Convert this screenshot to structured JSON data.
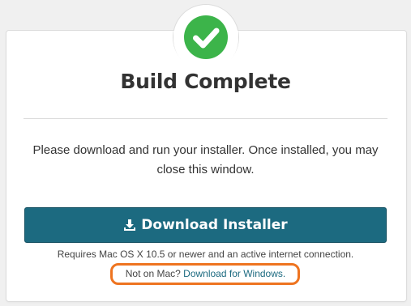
{
  "dialog": {
    "title": "Build Complete",
    "status_icon": "check-circle-icon",
    "message": "Please download and run your installer. Once installed, you may close this window.",
    "download_button": {
      "icon": "download-icon",
      "label": "Download Installer"
    },
    "requirements": "Requires Mac OS X 10.5 or newer and an active internet connection.",
    "alternate": {
      "prefix": "Not on Mac?",
      "link_label": "Download for Windows."
    }
  },
  "colors": {
    "success_green": "#3cb44a",
    "button_teal": "#1c6a80",
    "link_teal": "#1c6a80",
    "highlight_orange": "#ee7420"
  }
}
